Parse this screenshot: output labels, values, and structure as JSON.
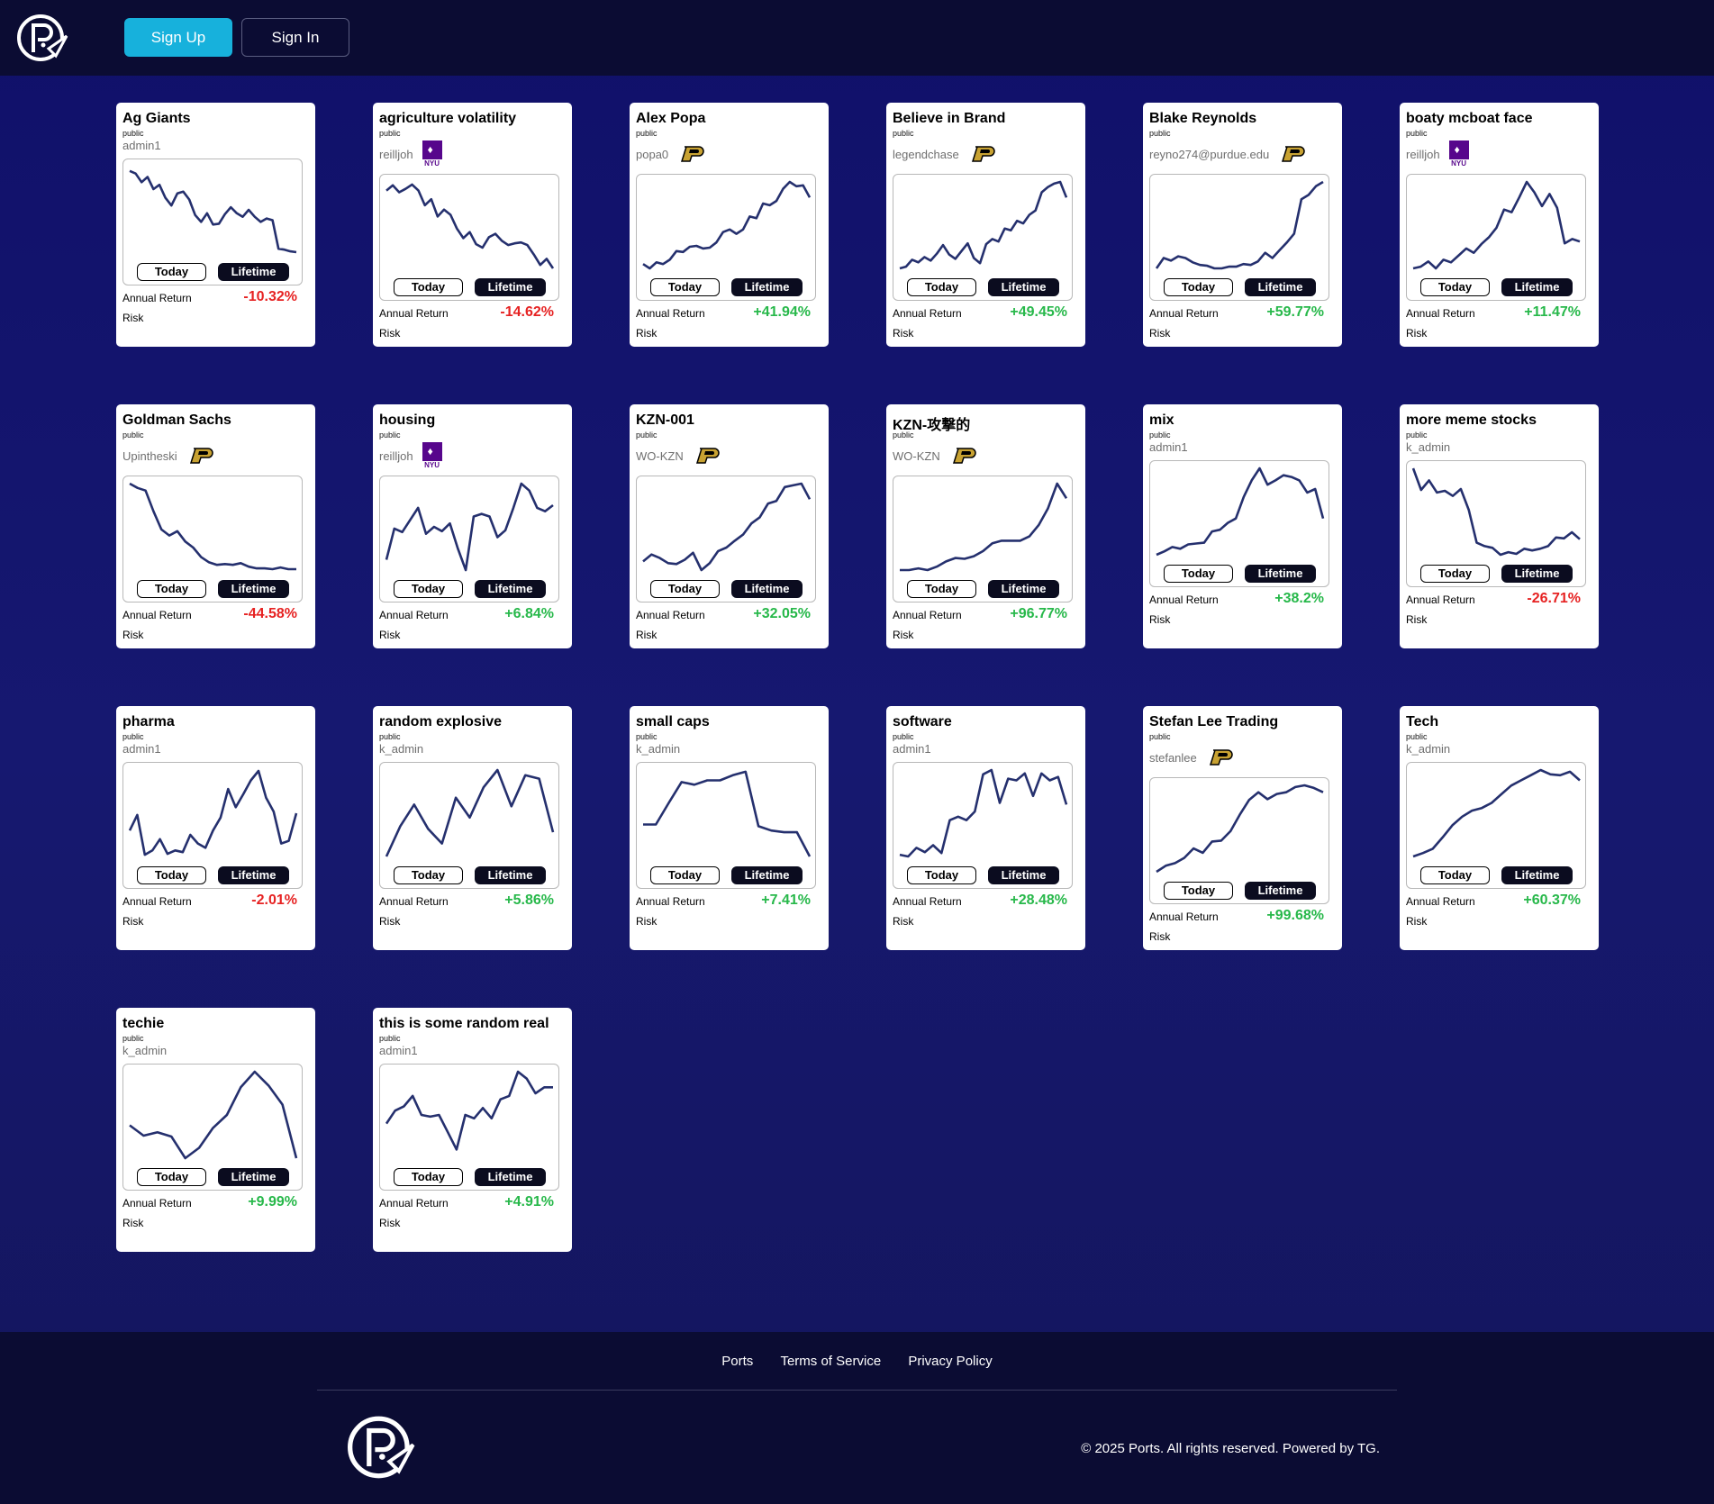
{
  "header": {
    "logo": "ports-logo",
    "signup_label": "Sign Up",
    "signin_label": "Sign In"
  },
  "labels": {
    "today": "Today",
    "lifetime": "Lifetime",
    "annual_return": "Annual Return",
    "risk": "Risk"
  },
  "colors": {
    "sparkline": "#25306e",
    "positive": "#27b84a",
    "negative": "#e62222",
    "signup": "#17b1dc"
  },
  "portfolios": [
    {
      "title": "Ag Giants",
      "visibility": "public",
      "owner": "admin1",
      "badge": "",
      "annual_return": "-10.32%",
      "trend": "negative",
      "series": [
        0.95,
        0.92,
        0.82,
        0.88,
        0.74,
        0.79,
        0.64,
        0.55,
        0.69,
        0.71,
        0.62,
        0.44,
        0.36,
        0.46,
        0.33,
        0.34,
        0.45,
        0.53,
        0.46,
        0.42,
        0.5,
        0.42,
        0.36,
        0.4,
        0.38,
        0.05,
        0.04,
        0.02,
        0.01
      ]
    },
    {
      "title": "agriculture volatility",
      "visibility": "public",
      "owner": "reilljoh",
      "badge": "nyu",
      "annual_return": "-14.62%",
      "trend": "negative",
      "series": [
        0.9,
        0.96,
        0.88,
        0.92,
        0.97,
        0.9,
        0.73,
        0.8,
        0.6,
        0.68,
        0.62,
        0.46,
        0.35,
        0.42,
        0.28,
        0.24,
        0.36,
        0.4,
        0.32,
        0.27,
        0.29,
        0.3,
        0.27,
        0.16,
        0.04,
        0.11,
        0.0
      ]
    },
    {
      "title": "Alex Popa",
      "visibility": "public",
      "owner": "popa0",
      "badge": "purdue",
      "annual_return": "+41.94%",
      "trend": "positive",
      "series": [
        0.05,
        0.0,
        0.07,
        0.05,
        0.1,
        0.2,
        0.19,
        0.25,
        0.26,
        0.23,
        0.24,
        0.3,
        0.42,
        0.45,
        0.4,
        0.45,
        0.6,
        0.58,
        0.75,
        0.73,
        0.78,
        0.92,
        1.0,
        0.95,
        0.96,
        0.82
      ]
    },
    {
      "title": "Believe in Brand",
      "visibility": "public",
      "owner": "legendchase",
      "badge": "purdue",
      "annual_return": "+49.45%",
      "trend": "positive",
      "series": [
        0.0,
        0.02,
        0.1,
        0.07,
        0.13,
        0.09,
        0.17,
        0.27,
        0.16,
        0.11,
        0.2,
        0.29,
        0.12,
        0.06,
        0.28,
        0.34,
        0.31,
        0.46,
        0.44,
        0.55,
        0.52,
        0.62,
        0.67,
        0.88,
        0.94,
        0.98,
        1.0,
        0.82
      ]
    },
    {
      "title": "Blake Reynolds",
      "visibility": "public",
      "owner": "reyno274@purdue.edu",
      "badge": "purdue",
      "annual_return": "+59.77%",
      "trend": "positive",
      "series": [
        0.0,
        0.12,
        0.09,
        0.14,
        0.12,
        0.07,
        0.04,
        0.03,
        0.0,
        0.0,
        0.02,
        0.02,
        0.05,
        0.04,
        0.08,
        0.18,
        0.12,
        0.21,
        0.3,
        0.4,
        0.8,
        0.85,
        0.95,
        1.0
      ]
    },
    {
      "title": "boaty mcboat face",
      "visibility": "public",
      "owner": "reilljoh",
      "badge": "nyu",
      "annual_return": "+11.47%",
      "trend": "positive",
      "series": [
        0.0,
        0.02,
        0.08,
        0.0,
        0.1,
        0.07,
        0.15,
        0.23,
        0.18,
        0.28,
        0.36,
        0.47,
        0.68,
        0.65,
        0.82,
        1.0,
        0.88,
        0.72,
        0.86,
        0.7,
        0.29,
        0.34,
        0.31
      ]
    },
    {
      "title": "Goldman Sachs",
      "visibility": "public",
      "owner": "Upintheski",
      "badge": "purdue",
      "annual_return": "-44.58%",
      "trend": "negative",
      "series": [
        1.0,
        0.95,
        0.92,
        0.68,
        0.47,
        0.4,
        0.45,
        0.33,
        0.26,
        0.15,
        0.09,
        0.06,
        0.07,
        0.06,
        0.08,
        0.04,
        0.02,
        0.02,
        0.01,
        0.03,
        0.01,
        0.01
      ]
    },
    {
      "title": "housing",
      "visibility": "public",
      "owner": "reilljoh",
      "badge": "nyu",
      "annual_return": "+6.84%",
      "trend": "positive",
      "series": [
        0.12,
        0.48,
        0.44,
        0.58,
        0.72,
        0.42,
        0.5,
        0.45,
        0.54,
        0.25,
        0.0,
        0.62,
        0.65,
        0.62,
        0.38,
        0.46,
        0.72,
        1.0,
        0.92,
        0.72,
        0.68,
        0.75
      ]
    },
    {
      "title": "KZN-001",
      "visibility": "public",
      "owner": "WO-KZN",
      "badge": "purdue",
      "annual_return": "+32.05%",
      "trend": "positive",
      "series": [
        0.1,
        0.18,
        0.14,
        0.08,
        0.07,
        0.12,
        0.2,
        0.0,
        0.08,
        0.22,
        0.26,
        0.34,
        0.41,
        0.54,
        0.61,
        0.77,
        0.8,
        0.96,
        0.98,
        1.0,
        0.82
      ]
    },
    {
      "title": "KZN-攻撃的",
      "visibility": "public",
      "owner": "WO-KZN",
      "badge": "purdue",
      "annual_return": "+96.77%",
      "trend": "positive",
      "series": [
        0.0,
        0.0,
        0.02,
        0.0,
        0.04,
        0.1,
        0.14,
        0.13,
        0.16,
        0.22,
        0.31,
        0.34,
        0.34,
        0.34,
        0.39,
        0.52,
        0.71,
        1.0,
        0.83
      ]
    },
    {
      "title": "mix",
      "visibility": "public",
      "owner": "admin1",
      "badge": "",
      "annual_return": "+38.2%",
      "trend": "positive",
      "series": [
        0.0,
        0.04,
        0.09,
        0.07,
        0.12,
        0.13,
        0.14,
        0.27,
        0.29,
        0.37,
        0.42,
        0.67,
        0.86,
        1.0,
        0.81,
        0.86,
        0.92,
        0.9,
        0.86,
        0.72,
        0.76,
        0.42
      ]
    },
    {
      "title": "more meme stocks",
      "visibility": "public",
      "owner": "k_admin",
      "badge": "",
      "annual_return": "-26.71%",
      "trend": "negative",
      "series": [
        1.0,
        0.75,
        0.86,
        0.72,
        0.74,
        0.68,
        0.76,
        0.52,
        0.14,
        0.1,
        0.08,
        0.0,
        0.03,
        0.01,
        0.07,
        0.05,
        0.07,
        0.1,
        0.2,
        0.19,
        0.26,
        0.18
      ]
    },
    {
      "title": "pharma",
      "visibility": "public",
      "owner": "admin1",
      "badge": "",
      "annual_return": "-2.01%",
      "trend": "negative",
      "series": [
        0.3,
        0.48,
        0.02,
        0.07,
        0.2,
        0.03,
        0.07,
        0.05,
        0.25,
        0.15,
        0.1,
        0.3,
        0.45,
        0.78,
        0.57,
        0.72,
        0.88,
        0.99,
        0.68,
        0.52,
        0.15,
        0.18,
        0.5
      ]
    },
    {
      "title": "random explosive",
      "visibility": "public",
      "owner": "k_admin",
      "badge": "",
      "annual_return": "+5.86%",
      "trend": "positive",
      "series": [
        0.0,
        0.35,
        0.6,
        0.32,
        0.15,
        0.68,
        0.45,
        0.8,
        1.0,
        0.58,
        0.94,
        0.9,
        0.28
      ]
    },
    {
      "title": "small caps",
      "visibility": "public",
      "owner": "k_admin",
      "badge": "",
      "annual_return": "+7.41%",
      "trend": "positive",
      "series": [
        0.37,
        0.37,
        0.62,
        0.86,
        0.83,
        0.88,
        0.88,
        0.94,
        0.98,
        0.35,
        0.3,
        0.28,
        0.28,
        0.0
      ]
    },
    {
      "title": "software",
      "visibility": "public",
      "owner": "admin1",
      "badge": "",
      "annual_return": "+28.48%",
      "trend": "positive",
      "series": [
        0.02,
        0.0,
        0.1,
        0.05,
        0.13,
        0.04,
        0.42,
        0.46,
        0.42,
        0.52,
        0.95,
        1.0,
        0.62,
        0.9,
        0.88,
        0.96,
        0.7,
        0.96,
        0.88,
        0.92,
        0.6
      ]
    },
    {
      "title": "Stefan Lee Trading",
      "visibility": "public",
      "owner": "stefanlee",
      "badge": "purdue",
      "annual_return": "+99.68%",
      "trend": "positive",
      "series": [
        0.0,
        0.07,
        0.1,
        0.16,
        0.27,
        0.22,
        0.35,
        0.36,
        0.47,
        0.66,
        0.83,
        0.92,
        0.84,
        0.9,
        0.92,
        0.98,
        1.0,
        0.97,
        0.92
      ]
    },
    {
      "title": "Tech",
      "visibility": "public",
      "owner": "k_admin",
      "badge": "",
      "annual_return": "+60.37%",
      "trend": "positive",
      "series": [
        0.0,
        0.04,
        0.09,
        0.22,
        0.36,
        0.46,
        0.53,
        0.56,
        0.62,
        0.72,
        0.82,
        0.88,
        0.94,
        1.0,
        0.95,
        0.94,
        0.98,
        0.88
      ]
    },
    {
      "title": "techie",
      "visibility": "public",
      "owner": "k_admin",
      "badge": "",
      "annual_return": "+9.99%",
      "trend": "positive",
      "series": [
        0.38,
        0.26,
        0.3,
        0.25,
        0.0,
        0.12,
        0.35,
        0.5,
        0.82,
        1.0,
        0.84,
        0.62,
        0.0
      ]
    },
    {
      "title": "this is some random real",
      "visibility": "public",
      "owner": "admin1",
      "badge": "",
      "annual_return": "+4.91%",
      "trend": "positive",
      "series": [
        0.4,
        0.55,
        0.6,
        0.72,
        0.5,
        0.48,
        0.5,
        0.3,
        0.1,
        0.5,
        0.46,
        0.58,
        0.46,
        0.68,
        0.72,
        1.0,
        0.92,
        0.75,
        0.82,
        0.82
      ]
    }
  ],
  "footer": {
    "links": [
      "Ports",
      "Terms of Service",
      "Privacy Policy"
    ],
    "copyright": "© 2025 Ports. All rights reserved. Powered by TG.",
    "logo": "ports-logo"
  }
}
